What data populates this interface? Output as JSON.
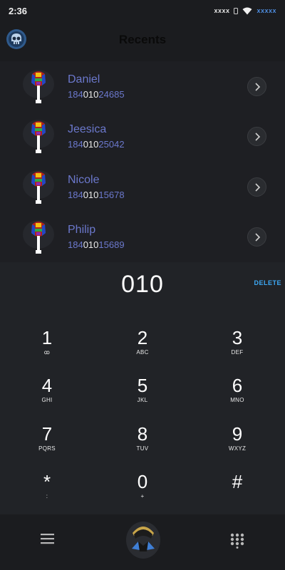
{
  "status_bar": {
    "time": "2:36",
    "carrier_left": "xxxx",
    "carrier_right": "xxxxx"
  },
  "header": {
    "title": "Recents"
  },
  "recents": [
    {
      "name": "Daniel",
      "number_pre": "184",
      "number_match": "010",
      "number_post": "24685"
    },
    {
      "name": "Jeesica",
      "number_pre": "184",
      "number_match": "010",
      "number_post": "25042"
    },
    {
      "name": "Nicole",
      "number_pre": "184",
      "number_match": "010",
      "number_post": "15678"
    },
    {
      "name": "Philip",
      "number_pre": "184",
      "number_match": "010",
      "number_post": "15689"
    }
  ],
  "dial": {
    "value": "010",
    "delete_label": "DELETE"
  },
  "keypad": [
    {
      "digit": "1",
      "letters": "ꝏ"
    },
    {
      "digit": "2",
      "letters": "ABC"
    },
    {
      "digit": "3",
      "letters": "DEF"
    },
    {
      "digit": "4",
      "letters": "GHI"
    },
    {
      "digit": "5",
      "letters": "JKL"
    },
    {
      "digit": "6",
      "letters": "MNO"
    },
    {
      "digit": "7",
      "letters": "PQRS"
    },
    {
      "digit": "8",
      "letters": "TUV"
    },
    {
      "digit": "9",
      "letters": "WXYZ"
    },
    {
      "digit": "*",
      "letters": ":"
    },
    {
      "digit": "0",
      "letters": "+"
    },
    {
      "digit": "#",
      "letters": ""
    }
  ],
  "icons": {
    "logo": "skull-logo-icon",
    "avatar": "mask-avatar-icon",
    "arrow": "chevron-right-icon",
    "menu": "menu-icon",
    "call": "call-mascot-icon",
    "dialpad": "dialpad-icon"
  },
  "colors": {
    "background": "#212327",
    "list_background": "#1e1f23",
    "name_color": "#6b78cc",
    "accent_blue": "#3da9f5"
  }
}
